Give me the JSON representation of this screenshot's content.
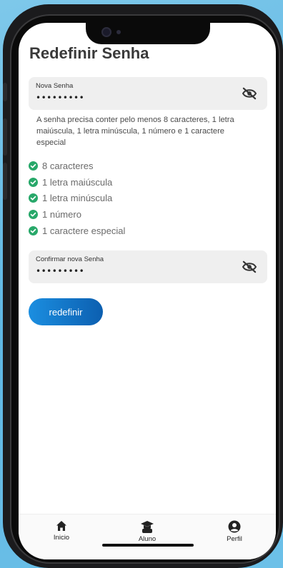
{
  "page": {
    "title": "Redefinir Senha"
  },
  "new_password": {
    "label": "Nova Senha",
    "value": "•••••••••",
    "icon": "eye-off-icon"
  },
  "hint": "A senha precisa conter pelo menos 8 caracteres, 1 letra maiúscula, 1 letra minúscula, 1 número e 1 caractere especial",
  "requirements": [
    {
      "label": "8 caracteres",
      "met": true
    },
    {
      "label": "1 letra maiúscula",
      "met": true
    },
    {
      "label": "1 letra minúscula",
      "met": true
    },
    {
      "label": "1 número",
      "met": true
    },
    {
      "label": "1 caractere especial",
      "met": true
    }
  ],
  "confirm_password": {
    "label": "Confirmar nova Senha",
    "value": "•••••••••",
    "icon": "eye-off-icon"
  },
  "submit_label": "redefinir",
  "nav": {
    "items": [
      {
        "label": "Inicio",
        "icon": "home-icon"
      },
      {
        "label": "Aluno",
        "icon": "graduation-cap-icon"
      },
      {
        "label": "Perfil",
        "icon": "user-circle-icon"
      }
    ]
  },
  "colors": {
    "accent_start": "#1b8ee0",
    "accent_end": "#0c5fb0",
    "check_green": "#28a86a",
    "field_bg": "#efefef"
  }
}
